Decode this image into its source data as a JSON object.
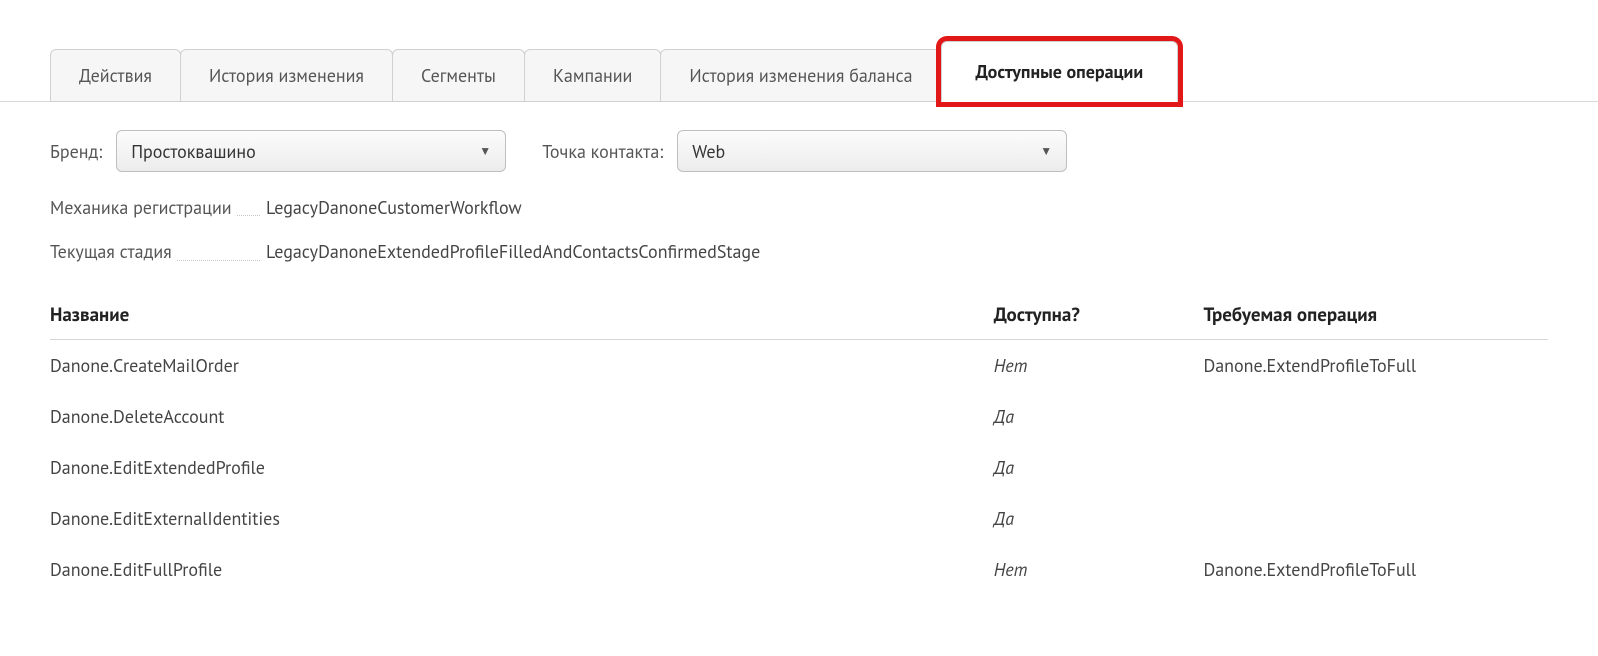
{
  "tabs": [
    {
      "label": "Действия",
      "active": false
    },
    {
      "label": "История изменения",
      "active": false
    },
    {
      "label": "Сегменты",
      "active": false
    },
    {
      "label": "Кампании",
      "active": false
    },
    {
      "label": "История изменения баланса",
      "active": false
    },
    {
      "label": "Доступные операции",
      "active": true
    }
  ],
  "filters": {
    "brand_label": "Бренд:",
    "brand_value": "Простоквашино",
    "contact_label": "Точка контакта:",
    "contact_value": "Web"
  },
  "info": {
    "mechanic_label": "Механика регистрации",
    "mechanic_value": "LegacyDanoneCustomerWorkflow",
    "stage_label": "Текущая стадия",
    "stage_value": "LegacyDanoneExtendedProfileFilledAndContactsConfirmedStage"
  },
  "table": {
    "headers": {
      "name": "Название",
      "available": "Доступна?",
      "required": "Требуемая операция"
    },
    "status_text": {
      "yes": "Да",
      "no": "Нет"
    },
    "rows": [
      {
        "name": "Danone.CreateMailOrder",
        "available": false,
        "required": "Danone.ExtendProfileToFull"
      },
      {
        "name": "Danone.DeleteAccount",
        "available": true,
        "required": ""
      },
      {
        "name": "Danone.EditExtendedProfile",
        "available": true,
        "required": ""
      },
      {
        "name": "Danone.EditExternalIdentities",
        "available": true,
        "required": ""
      },
      {
        "name": "Danone.EditFullProfile",
        "available": false,
        "required": "Danone.ExtendProfileToFull"
      }
    ]
  }
}
